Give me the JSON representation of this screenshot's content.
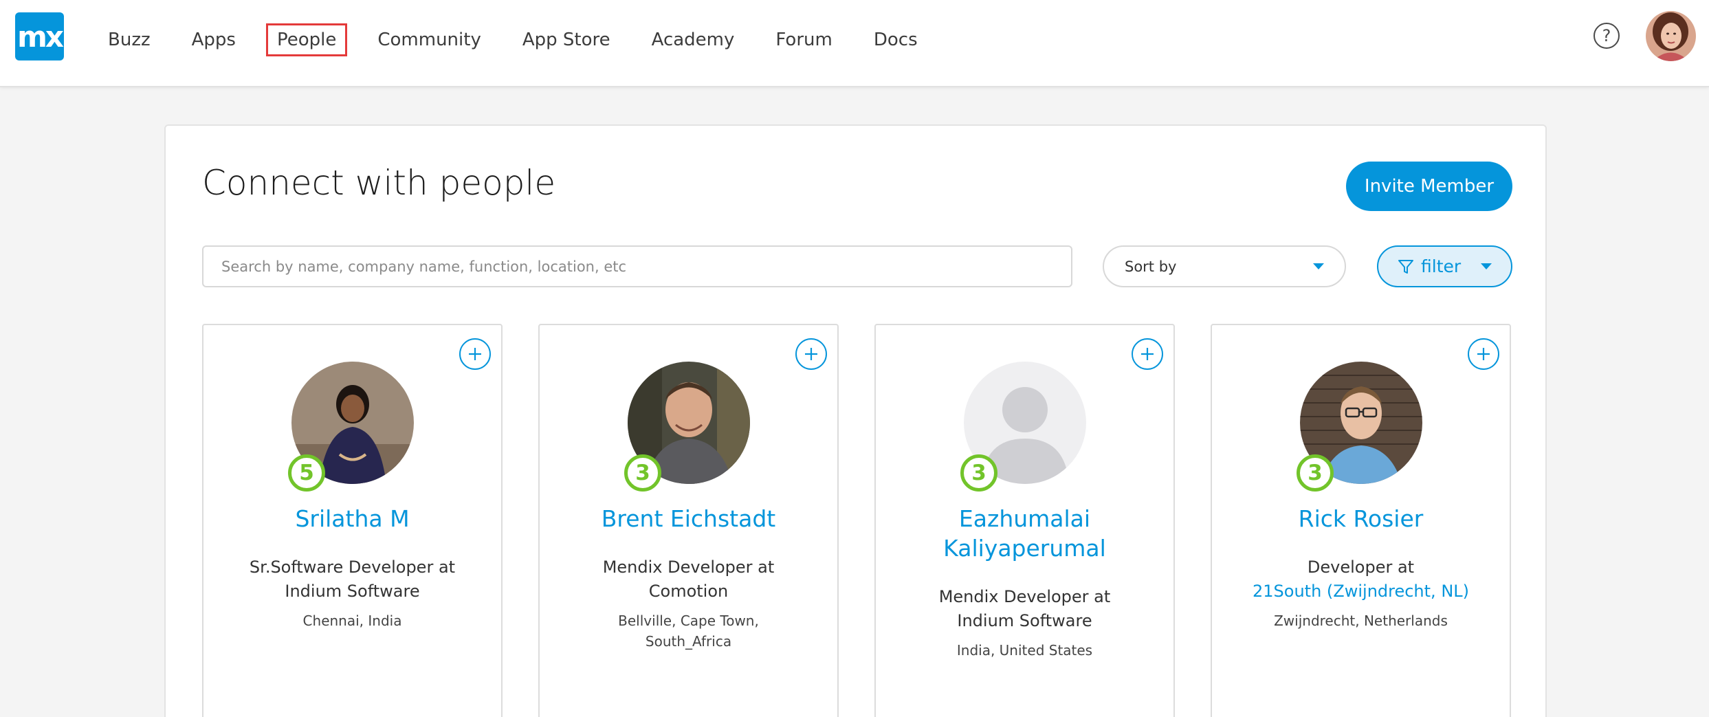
{
  "topbar": {
    "logo_text": "mx",
    "nav": [
      {
        "label": "Buzz",
        "active": false
      },
      {
        "label": "Apps",
        "active": false
      },
      {
        "label": "People",
        "active": true
      },
      {
        "label": "Community",
        "active": false
      },
      {
        "label": "App Store",
        "active": false
      },
      {
        "label": "Academy",
        "active": false
      },
      {
        "label": "Forum",
        "active": false
      },
      {
        "label": "Docs",
        "active": false
      }
    ],
    "help_icon": "question-circle-icon",
    "help_glyph": "?"
  },
  "colors": {
    "accent": "#0595db",
    "level_badge": "#72c42a",
    "active_nav_outline": "#e43a3a",
    "page_background": "#f4f4f4"
  },
  "main": {
    "title": "Connect with people",
    "invite_label": "Invite Member",
    "search_placeholder": "Search by name, company name, function, location, etc",
    "sort_label": "Sort by",
    "filter_label": "filter"
  },
  "people": [
    {
      "name": "Srilatha M",
      "level": "5",
      "role_prefix": "Sr.Software Developer at",
      "company": "Indium Software",
      "company_is_link": false,
      "location_line1": "Chennai, India",
      "location_line2": "",
      "avatar": "photo"
    },
    {
      "name": "Brent Eichstadt",
      "level": "3",
      "role_prefix": "Mendix Developer at",
      "company": "Comotion",
      "company_is_link": false,
      "location_line1": "Bellville, Cape Town,",
      "location_line2": "South_Africa",
      "avatar": "photo"
    },
    {
      "name": "Eazhumalai Kaliyaperumal",
      "level": "3",
      "role_prefix": "Mendix Developer at",
      "company": "Indium Software",
      "company_is_link": false,
      "location_line1": "India, United States",
      "location_line2": "",
      "avatar": "placeholder"
    },
    {
      "name": "Rick Rosier",
      "level": "3",
      "role_prefix": "Developer at",
      "company": "21South (Zwijndrecht, NL)",
      "company_is_link": true,
      "location_line1": "Zwijndrecht, Netherlands",
      "location_line2": "",
      "avatar": "photo"
    }
  ]
}
